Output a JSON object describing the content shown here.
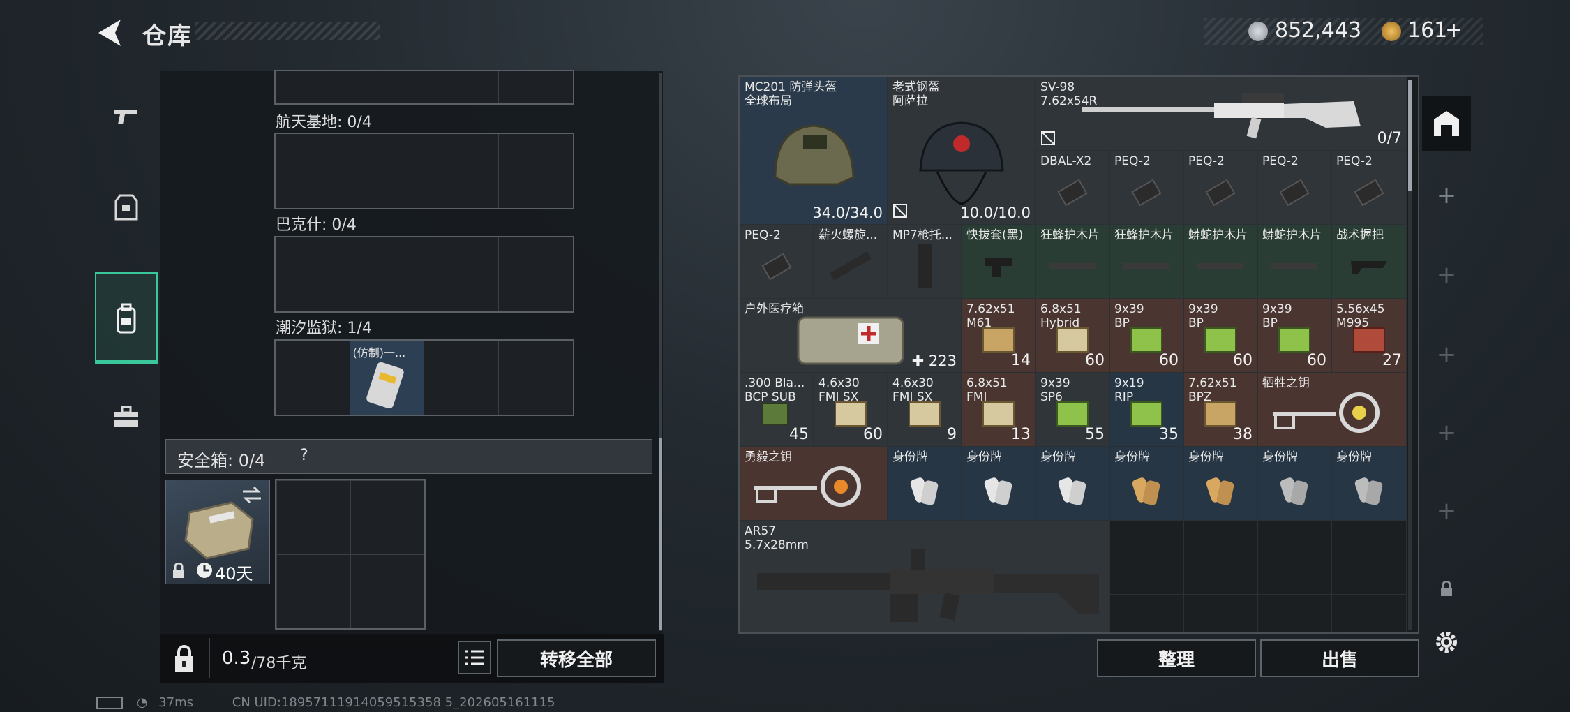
{
  "header": {
    "title": "仓库",
    "money": "852,443",
    "premium": "161",
    "plus": "+"
  },
  "left": {
    "sections": [
      {
        "label": "航天基地: 0/4"
      },
      {
        "label": "巴克什: 0/4"
      },
      {
        "label": "潮汐监狱: 1/4",
        "item_label": "(仿制)一..."
      }
    ],
    "safe": {
      "label": "安全箱: 0/4",
      "help": "?",
      "timer": "40天"
    },
    "weight": {
      "value": "0.3",
      "max": "/78千克"
    },
    "transfer_all": "转移全部"
  },
  "inventory": {
    "helmet1": {
      "name": "MC201 防弹头盔",
      "sub": "全球布局",
      "durability": "34.0/34.0"
    },
    "helmet2": {
      "name": "老式钢盔",
      "sub": "阿萨拉",
      "durability": "10.0/10.0"
    },
    "rifle": {
      "name": "SV-98",
      "sub": "7.62x54R",
      "count": "0/7"
    },
    "row2": [
      "DBAL-X2",
      "PEQ-2",
      "PEQ-2",
      "PEQ-2",
      "PEQ-2"
    ],
    "row3": [
      "PEQ-2",
      "薪火螺旋...",
      "MP7枪托...",
      "快拔套(黑)",
      "狂蜂护木片",
      "狂蜂护木片",
      "蟒蛇护木片",
      "蟒蛇护木片",
      "战术握把"
    ],
    "medkit": {
      "name": "户外医疗箱",
      "count": "223"
    },
    "ammo_row1": [
      {
        "name": "7.62x51",
        "sub": "M61",
        "count": "14"
      },
      {
        "name": "6.8x51",
        "sub": "Hybrid",
        "count": "60"
      },
      {
        "name": "9x39",
        "sub": "BP",
        "count": "60"
      },
      {
        "name": "9x39",
        "sub": "BP",
        "count": "60"
      },
      {
        "name": "9x39",
        "sub": "BP",
        "count": "60"
      },
      {
        "name": "5.56x45",
        "sub": "M995",
        "count": "27"
      }
    ],
    "ammo_row2": [
      {
        "name": ".300 Bla...",
        "sub": "BCP SUB",
        "count": "45"
      },
      {
        "name": "4.6x30",
        "sub": "FMJ SX",
        "count": "60"
      },
      {
        "name": "4.6x30",
        "sub": "FMJ SX",
        "count": "9"
      },
      {
        "name": "6.8x51",
        "sub": "FMJ",
        "count": "13"
      },
      {
        "name": "9x39",
        "sub": "SP6",
        "count": "55"
      },
      {
        "name": "9x19",
        "sub": "RIP",
        "count": "35"
      },
      {
        "name": "7.62x51",
        "sub": "BPZ",
        "count": "38"
      }
    ],
    "key1": "牺牲之钥",
    "key2": "勇毅之钥",
    "tags": [
      "身份牌",
      "身份牌",
      "身份牌",
      "身份牌",
      "身份牌",
      "身份牌",
      "身份牌"
    ],
    "ar": {
      "name": "AR57",
      "sub": "5.7x28mm"
    }
  },
  "actions": {
    "sort": "整理",
    "sell": "出售"
  },
  "footer": {
    "ping": "37ms",
    "uid": "CN UID:18957111914059515358 5_202605161115"
  },
  "colors": {
    "accent": "#3ac79a",
    "ammo_green": "#2a3d34",
    "blue_cell": "#2a3a4a"
  }
}
